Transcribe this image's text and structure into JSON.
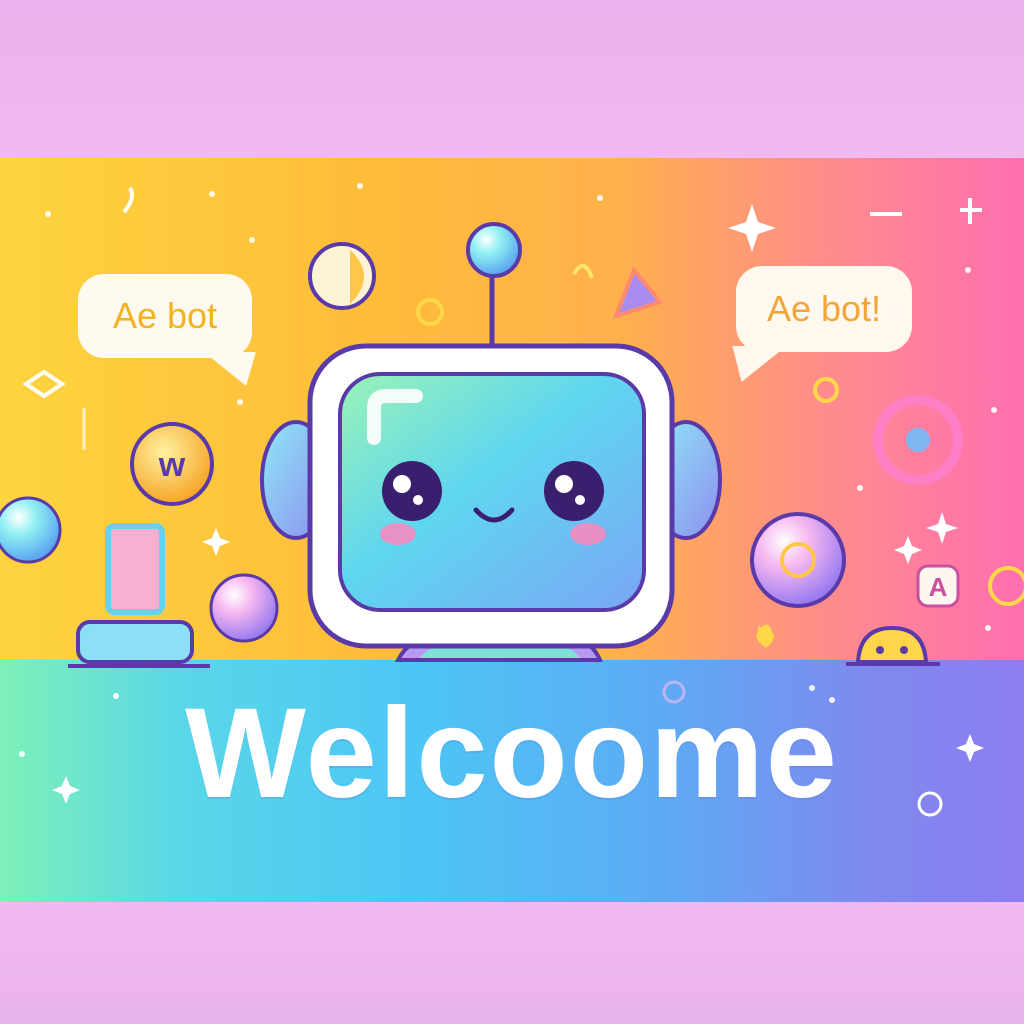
{
  "speech_bubbles": {
    "left": "Ae bot",
    "right": "Ae bot!"
  },
  "headline": "Welcoome",
  "side_ball_label": "w",
  "right_small_sign": "A",
  "colors": {
    "page_background": "#ecb8ef",
    "banner_gradient_start": "#fdd43f",
    "banner_gradient_end": "#ff6fb0",
    "floor_gradient_start": "#7ef0b8",
    "floor_gradient_end": "#8c7df0",
    "robot_outline": "#5a3aa8",
    "robot_screen": "#5fd6f0",
    "headline_text": "#ffffff"
  },
  "icons": [
    "robot-mascot",
    "sparkle-icon",
    "bubble-orb",
    "antenna-ball",
    "heart-icon",
    "triangle-shape",
    "mini-robot"
  ]
}
